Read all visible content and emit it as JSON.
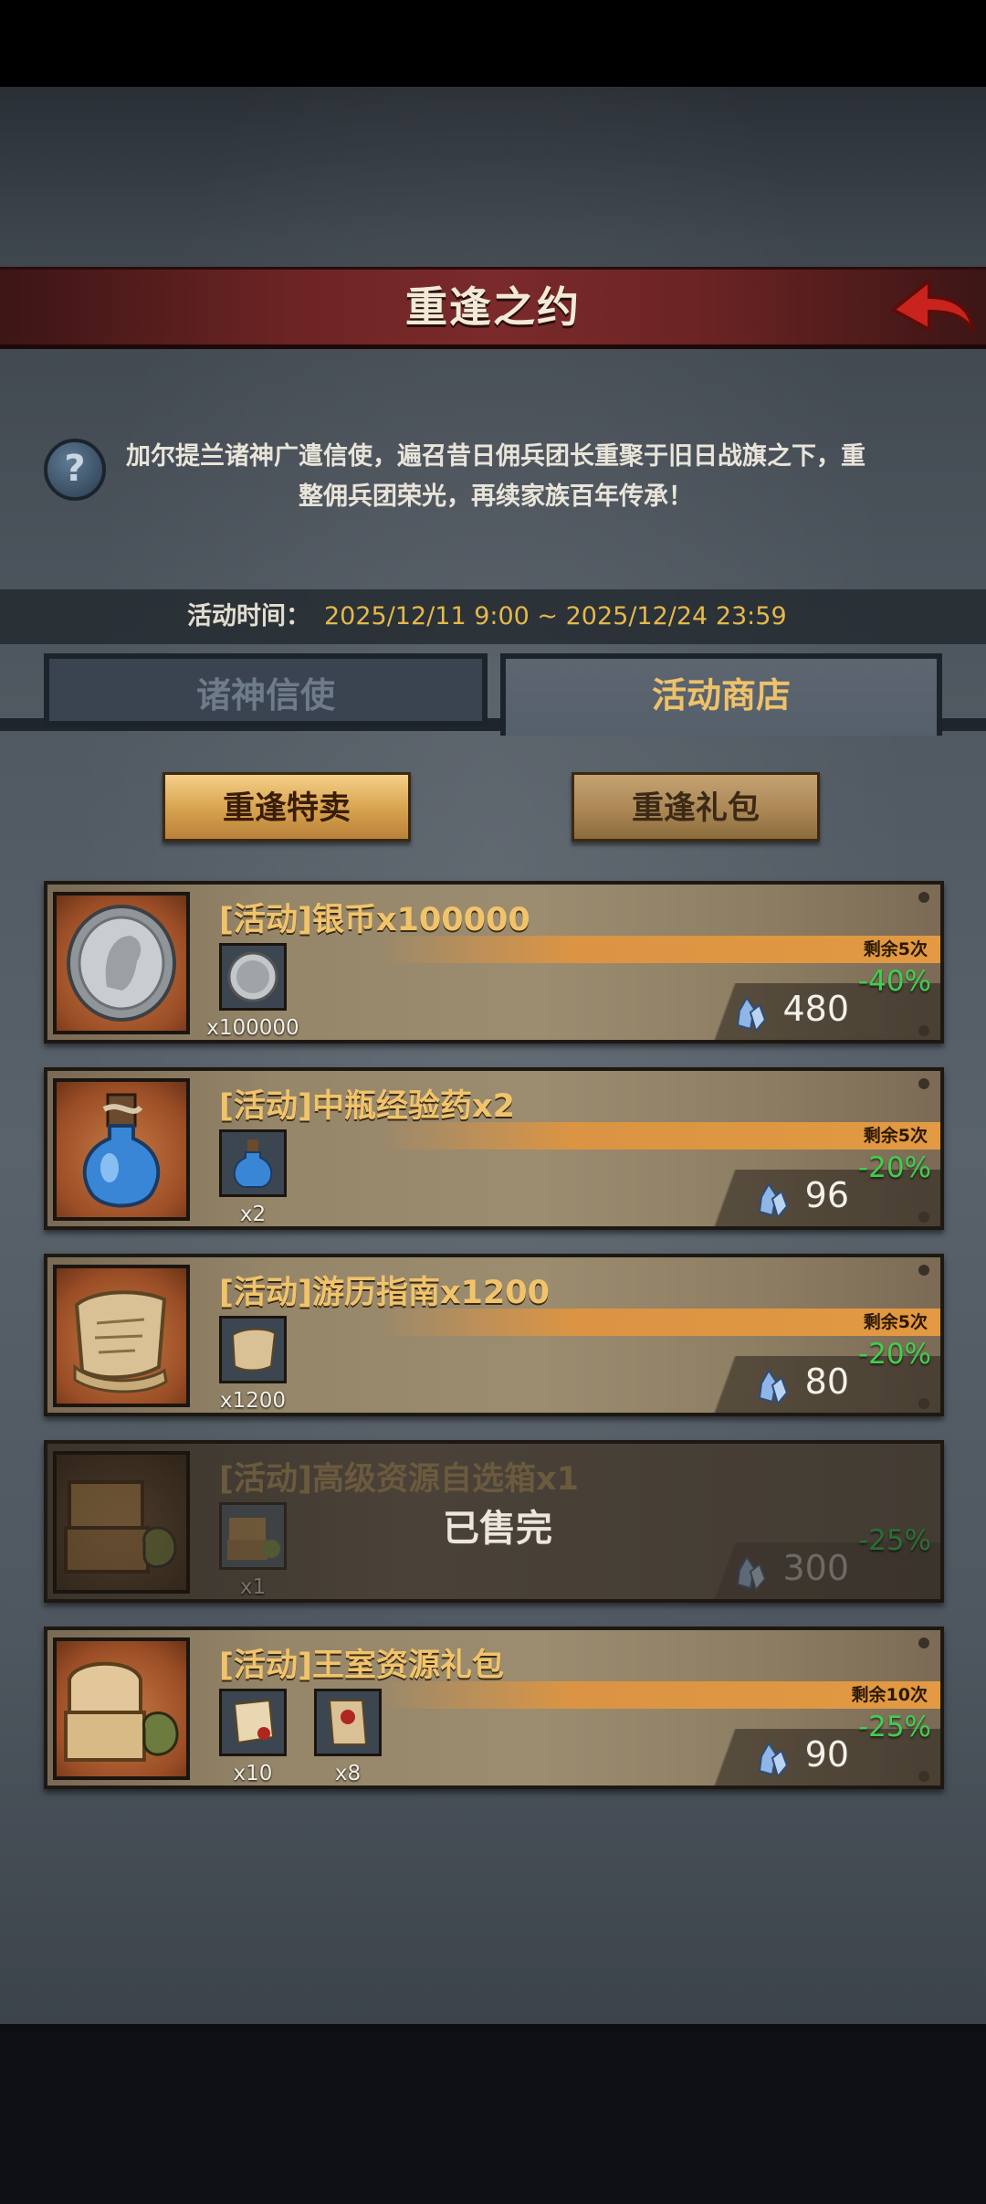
{
  "header": {
    "title": "重逢之约"
  },
  "description": "加尔提兰诸神广遣信使，遍召昔日佣兵团长重聚于旧日战旗之下，重整佣兵团荣光，再续家族百年传承！",
  "event_time": {
    "label": "活动时间：",
    "value": "2025/12/11 9:00 ~ 2025/12/24 23:59"
  },
  "tabs": [
    {
      "label": "诸神信使",
      "active": false
    },
    {
      "label": "活动商店",
      "active": true
    }
  ],
  "subtabs": [
    {
      "label": "重逢特卖",
      "active": true
    },
    {
      "label": "重逢礼包",
      "active": false
    }
  ],
  "shop": {
    "items": [
      {
        "title": "[活动]银币x100000",
        "remain": "剩余5次",
        "discount": "-40%",
        "price": "480",
        "rewards": [
          {
            "icon": "silver-coin-icon",
            "qty": "x100000"
          }
        ],
        "sold_out": false
      },
      {
        "title": "[活动]中瓶经验药x2",
        "remain": "剩余5次",
        "discount": "-20%",
        "price": "96",
        "rewards": [
          {
            "icon": "potion-icon",
            "qty": "x2"
          }
        ],
        "sold_out": false
      },
      {
        "title": "[活动]游历指南x1200",
        "remain": "剩余5次",
        "discount": "-20%",
        "price": "80",
        "rewards": [
          {
            "icon": "scroll-icon",
            "qty": "x1200"
          }
        ],
        "sold_out": false
      },
      {
        "title": "[活动]高级资源自选箱x1",
        "sold_label": "已售完",
        "discount": "-25%",
        "price": "300",
        "rewards": [
          {
            "icon": "resource-chest-icon",
            "qty": "x1"
          }
        ],
        "sold_out": true
      },
      {
        "title": "[活动]王室资源礼包",
        "remain": "剩余10次",
        "discount": "-25%",
        "price": "90",
        "rewards": [
          {
            "icon": "scroll-bundle-icon",
            "qty": "x10"
          },
          {
            "icon": "sealed-letter-icon",
            "qty": "x8"
          }
        ],
        "sold_out": false
      }
    ]
  },
  "colors": {
    "accent_gold": "#f1c46b",
    "discount_green": "#3fcf4e",
    "title_red": "#7a2a2a"
  }
}
